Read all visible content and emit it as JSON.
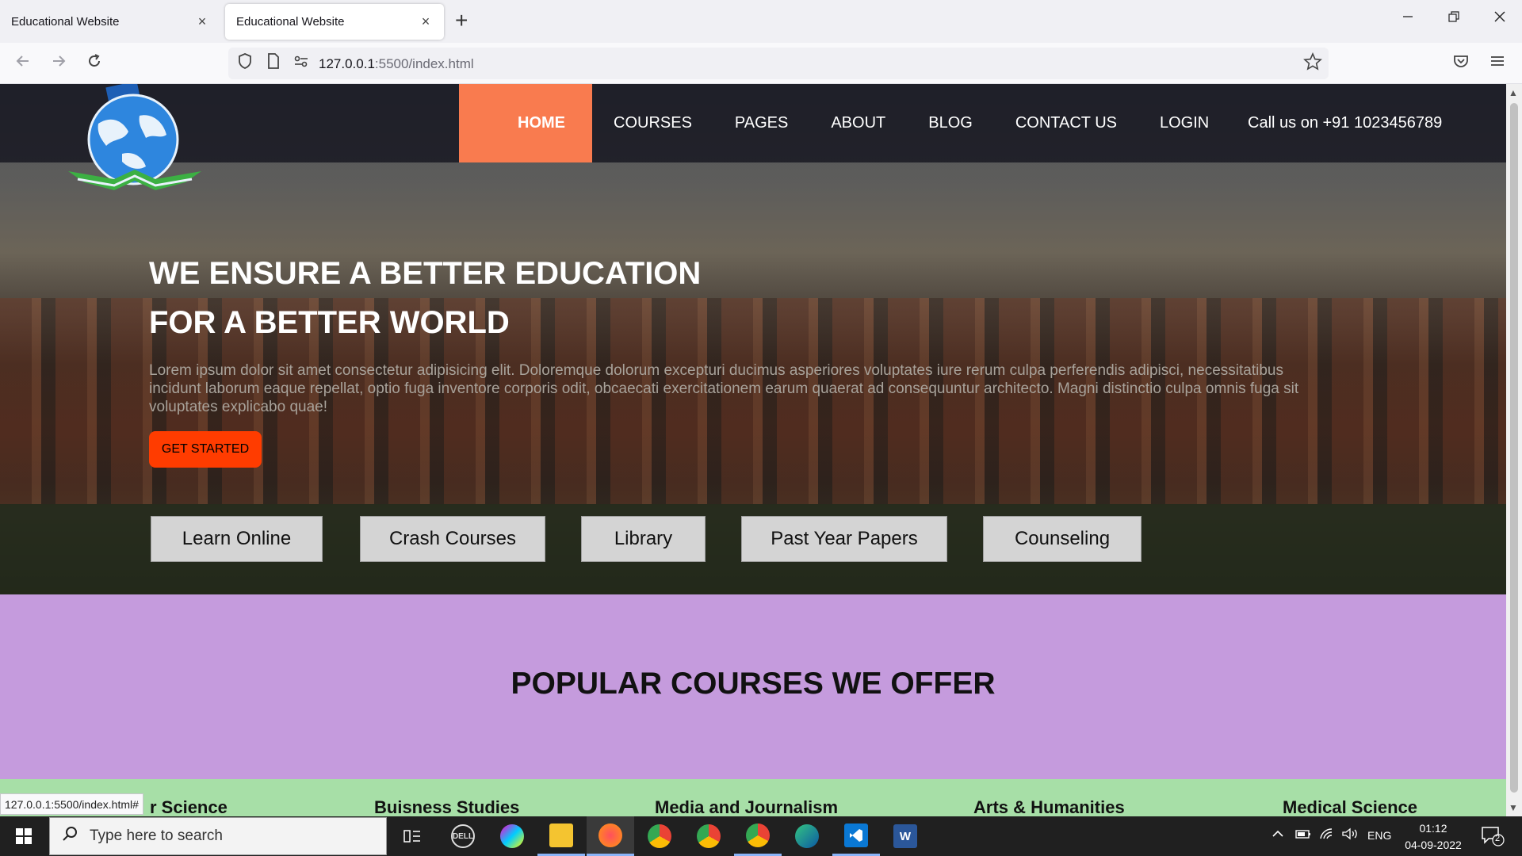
{
  "browser": {
    "tabs": [
      {
        "title": "Educational Website",
        "close": "×"
      },
      {
        "title": "Educational Website",
        "close": "×"
      }
    ],
    "new_tab": "+",
    "url_host": "127.0.0.1",
    "url_rest": ":5500/index.html",
    "status_url": "127.0.0.1:5500/index.html#"
  },
  "site": {
    "menu": [
      {
        "label": "HOME",
        "active": true
      },
      {
        "label": "COURSES"
      },
      {
        "label": "PAGES"
      },
      {
        "label": "ABOUT"
      },
      {
        "label": "BLOG"
      },
      {
        "label": "CONTACT US"
      },
      {
        "label": "LOGIN"
      }
    ],
    "phone": "Call us on +91 1023456789",
    "headline_line1": "WE ENSURE A BETTER EDUCATION",
    "headline_line2": "FOR A BETTER WORLD",
    "lorem": "Lorem ipsum dolor sit amet consectetur adipisicing elit. Doloremque dolorum excepturi ducimus asperiores voluptates iure rerum culpa perferendis adipisci, necessitatibus incidunt laborum eaque repellat, optio fuga inventore corporis odit, obcaecati exercitationem earum quaerat ad consequuntur architecto. Magni distinctio culpa omnis fuga sit voluptates explicabo quae!",
    "cta": "GET STARTED",
    "services": [
      "Learn Online",
      "Crash Courses",
      "Library",
      "Past Year Papers",
      "Counseling"
    ],
    "popular_title": "POPULAR COURSES WE OFFER",
    "courses": [
      "r Science",
      "Buisness Studies",
      "Media and Journalism",
      "Arts & Humanities",
      "Medical Science"
    ],
    "colors": {
      "accent": "#f97b4f",
      "cta": "#ff3c00",
      "popular_bg": "#c59bdd",
      "courses_bg": "#a7dfa7"
    }
  },
  "taskbar": {
    "search_placeholder": "Type here to search",
    "apps": [
      "task-view",
      "dell",
      "paint",
      "file-explorer",
      "firefox",
      "chrome",
      "chrome",
      "chrome",
      "edge",
      "vscode",
      "word"
    ],
    "lang": "ENG",
    "time": "01:12",
    "date": "04-09-2022",
    "notif_count": "2"
  }
}
